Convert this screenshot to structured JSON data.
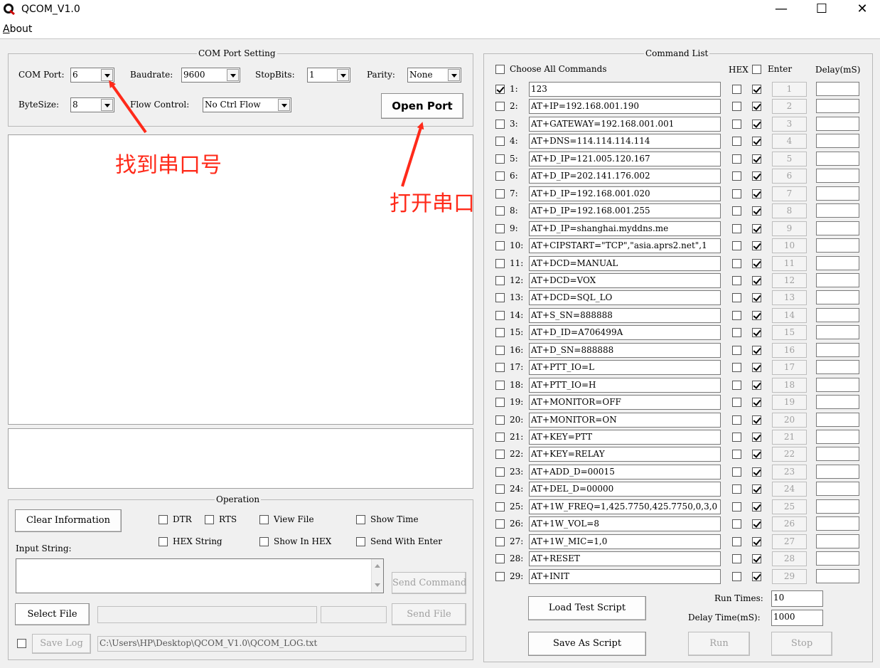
{
  "window": {
    "title": "QCOM_V1.0",
    "minimize_glyph": "—",
    "maximize_glyph": "☐",
    "close_glyph": "✕"
  },
  "menu": {
    "about": "About",
    "about_accel": "A",
    "about_rest": "bout"
  },
  "com_setting": {
    "title": "COM Port Setting",
    "com_port_label": "COM Port:",
    "com_port_value": "6",
    "baudrate_label": "Baudrate:",
    "baudrate_value": "9600",
    "stopbits_label": "StopBits:",
    "stopbits_value": "1",
    "parity_label": "Parity:",
    "parity_value": "None",
    "bytesize_label": "ByteSize:",
    "bytesize_value": "8",
    "flow_label": "Flow Control:",
    "flow_value": "No Ctrl Flow",
    "open_port": "Open Port"
  },
  "annotations": {
    "find_port": "找到串口号",
    "open_port": "打开串口",
    "color": "#ff2a1a"
  },
  "operation": {
    "title": "Operation",
    "clear_info": "Clear Information",
    "dtr": "DTR",
    "rts": "RTS",
    "view_file": "View File",
    "show_time": "Show Time",
    "hex_string": "HEX String",
    "show_in_hex": "Show In HEX",
    "send_with_enter": "Send With Enter",
    "input_label": "Input String:",
    "send_command": "Send Command",
    "select_file": "Select File",
    "send_file": "Send File",
    "save_log": "Save Log",
    "log_path": "C:\\Users\\HP\\Desktop\\QCOM_V1.0\\QCOM_LOG.txt"
  },
  "command_list": {
    "title": "Command List",
    "choose_all": "Choose All Commands",
    "hex_header": "HEX",
    "enter_header": "Enter",
    "delay_header": "Delay(mS)",
    "commands": [
      {
        "num": "1:",
        "btn": "1",
        "cmd": "123",
        "checked": true
      },
      {
        "num": "2:",
        "btn": "2",
        "cmd": "AT+IP=192.168.001.190",
        "checked": false
      },
      {
        "num": "3:",
        "btn": "3",
        "cmd": "AT+GATEWAY=192.168.001.001",
        "checked": false
      },
      {
        "num": "4:",
        "btn": "4",
        "cmd": "AT+DNS=114.114.114.114",
        "checked": false
      },
      {
        "num": "5:",
        "btn": "5",
        "cmd": "AT+D_IP=121.005.120.167",
        "checked": false
      },
      {
        "num": "6:",
        "btn": "6",
        "cmd": "AT+D_IP=202.141.176.002",
        "checked": false
      },
      {
        "num": "7:",
        "btn": "7",
        "cmd": "AT+D_IP=192.168.001.020",
        "checked": false
      },
      {
        "num": "8:",
        "btn": "8",
        "cmd": "AT+D_IP=192.168.001.255",
        "checked": false
      },
      {
        "num": "9:",
        "btn": "9",
        "cmd": "AT+D_IP=shanghai.myddns.me",
        "checked": false
      },
      {
        "num": "10:",
        "btn": "10",
        "cmd": "AT+CIPSTART=\"TCP\",\"asia.aprs2.net\",1",
        "checked": false
      },
      {
        "num": "11:",
        "btn": "11",
        "cmd": "AT+DCD=MANUAL",
        "checked": false
      },
      {
        "num": "12:",
        "btn": "12",
        "cmd": "AT+DCD=VOX",
        "checked": false
      },
      {
        "num": "13:",
        "btn": "13",
        "cmd": "AT+DCD=SQL_LO",
        "checked": false
      },
      {
        "num": "14:",
        "btn": "14",
        "cmd": "AT+S_SN=888888",
        "checked": false
      },
      {
        "num": "15:",
        "btn": "15",
        "cmd": "AT+D_ID=A706499A",
        "checked": false
      },
      {
        "num": "16:",
        "btn": "16",
        "cmd": "AT+D_SN=888888",
        "checked": false
      },
      {
        "num": "17:",
        "btn": "17",
        "cmd": "AT+PTT_IO=L",
        "checked": false
      },
      {
        "num": "18:",
        "btn": "18",
        "cmd": "AT+PTT_IO=H",
        "checked": false
      },
      {
        "num": "19:",
        "btn": "19",
        "cmd": "AT+MONITOR=OFF",
        "checked": false
      },
      {
        "num": "20:",
        "btn": "20",
        "cmd": "AT+MONITOR=ON",
        "checked": false
      },
      {
        "num": "21:",
        "btn": "21",
        "cmd": "AT+KEY=PTT",
        "checked": false
      },
      {
        "num": "22:",
        "btn": "22",
        "cmd": "AT+KEY=RELAY",
        "checked": false
      },
      {
        "num": "23:",
        "btn": "23",
        "cmd": "AT+ADD_D=00015",
        "checked": false
      },
      {
        "num": "24:",
        "btn": "24",
        "cmd": "AT+DEL_D=00000",
        "checked": false
      },
      {
        "num": "25:",
        "btn": "25",
        "cmd": "AT+1W_FREQ=1,425.7750,425.7750,0,3,0",
        "checked": false
      },
      {
        "num": "26:",
        "btn": "26",
        "cmd": "AT+1W_VOL=8",
        "checked": false
      },
      {
        "num": "27:",
        "btn": "27",
        "cmd": "AT+1W_MIC=1,0",
        "checked": false
      },
      {
        "num": "28:",
        "btn": "28",
        "cmd": "AT+RESET",
        "checked": false
      },
      {
        "num": "29:",
        "btn": "29",
        "cmd": "AT+INIT",
        "checked": false
      }
    ],
    "run_times_label": "Run Times:",
    "run_times_value": "10",
    "delay_time_label": "Delay Time(mS):",
    "delay_time_value": "1000",
    "load_script": "Load Test Script",
    "save_script": "Save As Script",
    "run": "Run",
    "stop": "Stop"
  }
}
